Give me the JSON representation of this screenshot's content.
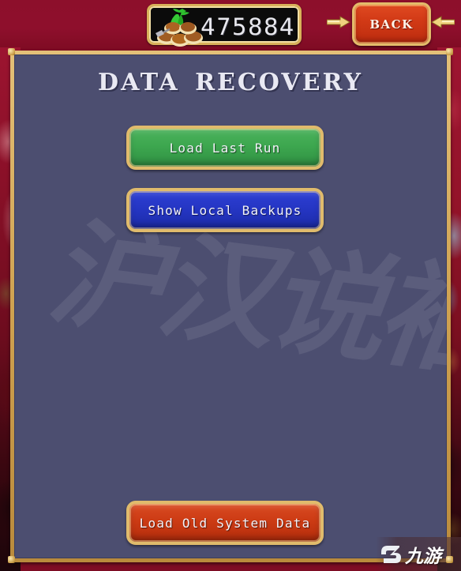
{
  "window": {
    "title": "DATA RECOVERY"
  },
  "topbar": {
    "currency": {
      "icon": "coin-pile-icon",
      "amount": "475884"
    },
    "back_button": {
      "label": "BACK",
      "left_arrow_icon": "arrow-right-gold-icon",
      "right_arrow_icon": "arrow-left-gold-icon"
    }
  },
  "panel": {
    "title": "DATA RECOVERY",
    "watermark_text": "沪汉说袖",
    "buttons": [
      {
        "id": "load-last-run",
        "label": "Load Last Run",
        "color": "#3da74f",
        "border_color": "#e0bb6c"
      },
      {
        "id": "show-local-backups",
        "label": "Show Local Backups",
        "color": "#2536c4",
        "border_color": "#e0bb6c"
      },
      {
        "id": "load-old-system-data",
        "label": "Load Old System Data",
        "color": "#cc3b14",
        "border_color": "#e0bb6c"
      }
    ],
    "background_color": "#4c4e70",
    "frame_color": "#cfa251"
  },
  "site_watermark": {
    "text": "九游",
    "mark": "jiuyou-logo-icon"
  },
  "theme": {
    "background_red": "#8e0f2c",
    "gold": "#e0bb6c",
    "panel_blue_gray": "#4c4e70"
  }
}
